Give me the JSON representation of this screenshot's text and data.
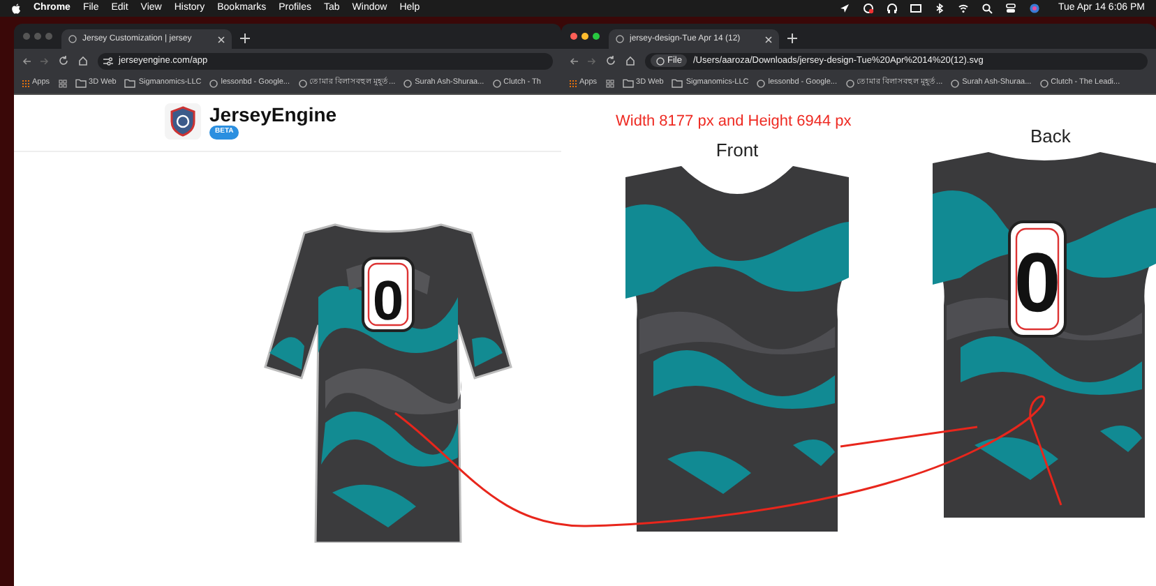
{
  "menu_bar": {
    "app": "Chrome",
    "items": [
      "File",
      "Edit",
      "View",
      "History",
      "Bookmarks",
      "Profiles",
      "Tab",
      "Window",
      "Help"
    ],
    "clock": "Tue Apr 14  6:06 PM"
  },
  "windows": [
    {
      "tab": "Jersey Customization | jersey",
      "address": "jerseyengine.com/app",
      "bookmarks": [
        "Apps",
        "3D Web",
        "Sigmanomics-LLC",
        "lessonbd - Google...",
        "তোমার বিলাসবহুল মুহূর্ত...",
        "Surah Ash-Shuraa...",
        "Clutch - Th"
      ],
      "page": {
        "kind": "app",
        "brand": "JerseyEngine",
        "badge": "BETA",
        "jersey_number": "0"
      }
    },
    {
      "tab": "jersey-design-Tue Apr 14 (12)",
      "address_chip": "File",
      "address": "/Users/aaroza/Downloads/jersey-design-Tue%20Apr%2014%20(12).svg",
      "bookmarks": [
        "Apps",
        "3D Web",
        "Sigmanomics-LLC",
        "lessonbd - Google...",
        "তোমার বিলাসবহুল মুহূর্ত...",
        "Surah Ash-Shuraa...",
        "Clutch - The Leadi..."
      ],
      "page": {
        "kind": "svg",
        "note": "Width 8177 px and Height 6944 px",
        "views": [
          {
            "label": "Front"
          },
          {
            "label": "Back",
            "number": "0"
          }
        ]
      }
    }
  ]
}
